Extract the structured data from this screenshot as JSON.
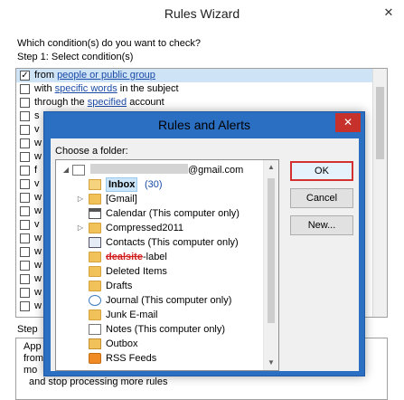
{
  "wizard": {
    "title": "Rules Wizard",
    "close_glyph": "✕",
    "question": "Which condition(s) do you want to check?",
    "step1": "Step 1: Select condition(s)",
    "conditions": [
      {
        "checked": true,
        "pre": "from ",
        "link": "people or public group",
        "post": ""
      },
      {
        "checked": false,
        "pre": "with ",
        "link": "specific words",
        "post": " in the subject"
      },
      {
        "checked": false,
        "pre": "through the ",
        "link": "specified",
        "post": " account"
      },
      {
        "checked": false,
        "pre": "s",
        "link": "",
        "post": ""
      },
      {
        "checked": false,
        "pre": "v",
        "link": "",
        "post": ""
      },
      {
        "checked": false,
        "pre": "w",
        "link": "",
        "post": ""
      },
      {
        "checked": false,
        "pre": "w",
        "link": "",
        "post": ""
      },
      {
        "checked": false,
        "pre": "f",
        "link": "",
        "post": ""
      },
      {
        "checked": false,
        "pre": "v",
        "link": "",
        "post": ""
      },
      {
        "checked": false,
        "pre": "w",
        "link": "",
        "post": ""
      },
      {
        "checked": false,
        "pre": "w",
        "link": "",
        "post": ""
      },
      {
        "checked": false,
        "pre": "v",
        "link": "",
        "post": ""
      },
      {
        "checked": false,
        "pre": "w",
        "link": "",
        "post": ""
      },
      {
        "checked": false,
        "pre": "w",
        "link": "",
        "post": ""
      },
      {
        "checked": false,
        "pre": "w",
        "link": "",
        "post": ""
      },
      {
        "checked": false,
        "pre": "w",
        "link": "",
        "post": ""
      },
      {
        "checked": false,
        "pre": "w",
        "link": "",
        "post": ""
      },
      {
        "checked": false,
        "pre": "w",
        "link": "",
        "post": ""
      }
    ],
    "step2": "Step",
    "description_lines": [
      "App",
      "from",
      "mo",
      "and stop processing more rules"
    ]
  },
  "dialog": {
    "title": "Rules and Alerts",
    "close_glyph": "✕",
    "choose_label": "Choose a folder:",
    "account_suffix": "@gmail.com",
    "folders": [
      {
        "name": "Inbox",
        "count": "(30)",
        "selected": true,
        "icon": "inbox-folder-icon",
        "expander": ""
      },
      {
        "name": "[Gmail]",
        "count": "",
        "selected": false,
        "icon": "folder-icon",
        "expander": "▷"
      },
      {
        "name": "Calendar (This computer only)",
        "count": "",
        "selected": false,
        "icon": "calendar-icon",
        "expander": ""
      },
      {
        "name": "Compressed2011",
        "count": "",
        "selected": false,
        "icon": "folder-icon",
        "expander": "▷"
      },
      {
        "name": "Contacts (This computer only)",
        "count": "",
        "selected": false,
        "icon": "contacts-icon",
        "expander": ""
      },
      {
        "name": "-label",
        "count": "",
        "selected": false,
        "icon": "folder-icon",
        "expander": "",
        "redacted_prefix": "dealsite"
      },
      {
        "name": "Deleted Items",
        "count": "",
        "selected": false,
        "icon": "folder-icon",
        "expander": ""
      },
      {
        "name": "Drafts",
        "count": "",
        "selected": false,
        "icon": "folder-icon",
        "expander": ""
      },
      {
        "name": "Journal (This computer only)",
        "count": "",
        "selected": false,
        "icon": "journal-icon",
        "expander": ""
      },
      {
        "name": "Junk E-mail",
        "count": "",
        "selected": false,
        "icon": "folder-icon",
        "expander": ""
      },
      {
        "name": "Notes (This computer only)",
        "count": "",
        "selected": false,
        "icon": "notes-icon",
        "expander": ""
      },
      {
        "name": "Outbox",
        "count": "",
        "selected": false,
        "icon": "outbox-icon",
        "expander": ""
      },
      {
        "name": "RSS Feeds",
        "count": "",
        "selected": false,
        "icon": "rss-icon",
        "expander": ""
      }
    ],
    "buttons": {
      "ok": "OK",
      "cancel": "Cancel",
      "new": "New..."
    }
  },
  "colors": {
    "dialog_frame": "#2b6fc2",
    "close_red": "#c7312b",
    "selection": "#cce4f7",
    "link": "#1a4aa6"
  }
}
